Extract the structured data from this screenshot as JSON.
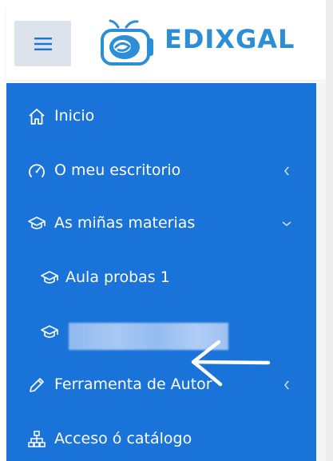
{
  "app": {
    "brand_name": "EDIXGAL",
    "brand_color": "#2b8ed6",
    "sidebar_color": "#1a73d9"
  },
  "header": {
    "menu_icon": "hamburger-icon"
  },
  "sidebar": {
    "items": [
      {
        "label": "Inicio",
        "icon": "home-icon"
      },
      {
        "label": "O meu escritorio",
        "icon": "speedometer-icon",
        "chevron": "left"
      },
      {
        "label": "As miñas materias",
        "icon": "graduation-cap-icon",
        "chevron": "down"
      },
      {
        "label": "Aula probas 1",
        "icon": "graduation-cap-icon"
      },
      {
        "label": "",
        "icon": "graduation-cap-icon"
      },
      {
        "label": "Ferramenta de Autor",
        "icon": "pencil-icon",
        "chevron": "left"
      },
      {
        "label": "Acceso ó catálogo",
        "icon": "sitemap-icon"
      }
    ]
  }
}
